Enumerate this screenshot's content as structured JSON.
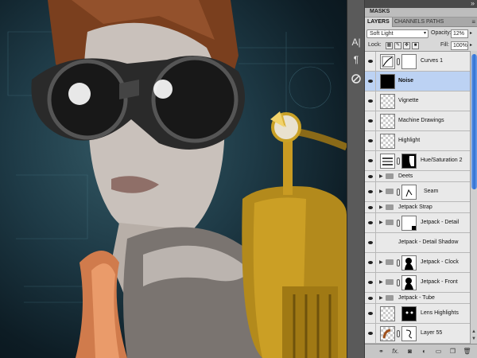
{
  "panel": {
    "collapse_icon": "double-chevron-right-icon",
    "masks_title": "MASKS",
    "tabs": [
      "LAYERS",
      "CHANNELS",
      "PATHS"
    ],
    "blend_mode": "Soft Light",
    "opacity_label": "Opacity:",
    "opacity_value": "12%",
    "lock_label": "Lock:",
    "fill_label": "Fill:",
    "fill_value": "100%"
  },
  "layers": [
    {
      "name": "Curves 1",
      "kind": "adjustment",
      "visible": true
    },
    {
      "name": "Noise",
      "kind": "layer",
      "visible": true,
      "selected": true
    },
    {
      "name": "Vignette",
      "kind": "layer",
      "visible": true
    },
    {
      "name": "Machine Drawings",
      "kind": "layer",
      "visible": true
    },
    {
      "name": "Highlight",
      "kind": "layer",
      "visible": true
    },
    {
      "name": "Hue/Saturation 2",
      "kind": "adjustment",
      "visible": true
    },
    {
      "name": "Deets",
      "kind": "group",
      "visible": true
    },
    {
      "name": "Seam",
      "kind": "masked",
      "visible": true
    },
    {
      "name": "Jetpack Strap",
      "kind": "group",
      "visible": true
    },
    {
      "name": "Jetpack - Detail",
      "kind": "masked",
      "visible": true
    },
    {
      "name": "Jetpack - Detail Shadow",
      "kind": "layer",
      "visible": true
    },
    {
      "name": "Jetpack - Clock",
      "kind": "masked",
      "visible": true
    },
    {
      "name": "Jetpack - Front",
      "kind": "masked",
      "visible": true
    },
    {
      "name": "Jetpack - Tube",
      "kind": "group",
      "visible": true
    },
    {
      "name": "Lens Highlights",
      "kind": "layer",
      "visible": true
    },
    {
      "name": "Layer 55",
      "kind": "masked",
      "visible": true
    }
  ],
  "bottom_icons": [
    "link-layers-icon",
    "fx-icon",
    "add-mask-icon",
    "adjustment-layer-icon",
    "new-group-icon",
    "new-layer-icon",
    "trash-icon"
  ],
  "bottom_labels": {
    "fx": "fx."
  },
  "dock_icons": [
    "character-panel-icon",
    "paragraph-panel-icon",
    "brush-preset-icon"
  ],
  "dock_labels": {
    "character": "A|",
    "paragraph": "¶"
  }
}
